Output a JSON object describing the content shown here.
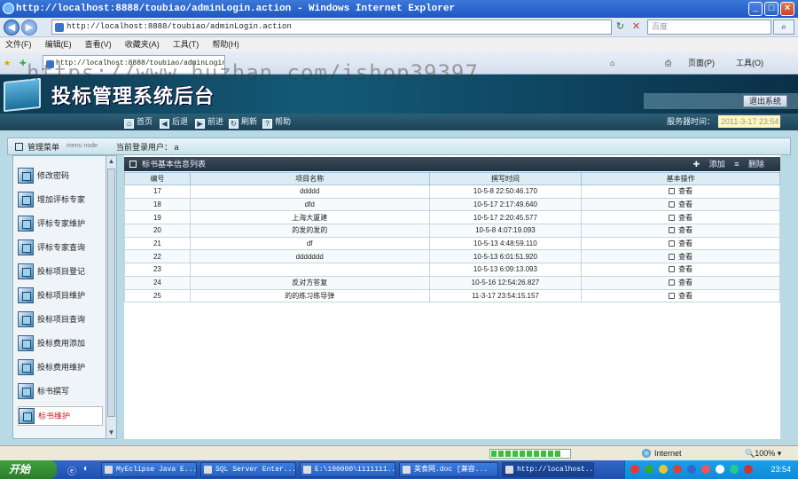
{
  "browser": {
    "title": "http://localhost:8888/toubiao/adminLogin.action - Windows Internet Explorer",
    "url": "http://localhost:8888/toubiao/adminLogin.action",
    "search_placeholder": "百度",
    "menu": [
      "文件(F)",
      "编辑(E)",
      "查看(V)",
      "收藏夹(A)",
      "工具(T)",
      "帮助(H)"
    ],
    "tab_title": "http://localhost:8888/toubiao/adminLogin...",
    "page_menu": "页面(P)",
    "tools_menu": "工具(O)"
  },
  "watermark": "https://www.huzhan.com/ishop39397",
  "app": {
    "title": "投标管理系统后台",
    "logout": "退出系统",
    "nav": [
      {
        "label": "首页",
        "icon": "home-icon"
      },
      {
        "label": "后退",
        "icon": "back-icon"
      },
      {
        "label": "前进",
        "icon": "forward-icon"
      },
      {
        "label": "刷新",
        "icon": "refresh-icon"
      },
      {
        "label": "帮助",
        "icon": "help-icon"
      }
    ],
    "server_time_label": "服务器时间：",
    "server_time": "2011-3-17 23:54",
    "menu_title": "管理菜单",
    "menu_sub": "menu node",
    "current_user_label": "当前登录用户：",
    "current_user": "a"
  },
  "sidebar": {
    "items": [
      {
        "label": "修改密码"
      },
      {
        "label": "增加评标专家"
      },
      {
        "label": "评标专家维护"
      },
      {
        "label": "评标专家查询"
      },
      {
        "label": "投标项目登记"
      },
      {
        "label": "投标项目维护"
      },
      {
        "label": "投标项目查询"
      },
      {
        "label": "投标费用添加"
      },
      {
        "label": "投标费用维护"
      },
      {
        "label": "标书撰写"
      },
      {
        "label": "标书维护"
      }
    ]
  },
  "table": {
    "title": "标书基本信息列表",
    "add": "添加",
    "delete": "删除",
    "columns": [
      "编号",
      "项目名称",
      "撰写时间",
      "基本操作"
    ],
    "view_label": "查看",
    "rows": [
      {
        "id": "17",
        "name": "ddddd",
        "time": "10-5-8 22:50:46.170"
      },
      {
        "id": "18",
        "name": "dfd",
        "time": "10-5-17 2:17:49.640"
      },
      {
        "id": "19",
        "name": "上海大厦建",
        "time": "10-5-17 2:20:45.577"
      },
      {
        "id": "20",
        "name": "的发的发的",
        "time": "10-5-8 4:07:19.093"
      },
      {
        "id": "21",
        "name": "df",
        "time": "10-5-13 4:48:59.110"
      },
      {
        "id": "22",
        "name": "ddddddd",
        "time": "10-5-13 6:01:51.920"
      },
      {
        "id": "23",
        "name": "",
        "time": "10-5-13 6:09:13.093"
      },
      {
        "id": "24",
        "name": "反对方答复",
        "time": "10-5-16 12:54:26.827"
      },
      {
        "id": "25",
        "name": "的的练习练导弹",
        "time": "11-3-17 23:54:15.157"
      }
    ]
  },
  "status": {
    "zone": "Internet",
    "zoom": "100%",
    "progress": 0.9
  },
  "taskbar": {
    "start": "开始",
    "tasks": [
      "MyEclipse Java E...",
      "SQL Server Enter...",
      "E:\\100000\\1111111...",
      "美食网.doc [兼容...",
      "http://localhost..."
    ],
    "clock": "23:54"
  }
}
